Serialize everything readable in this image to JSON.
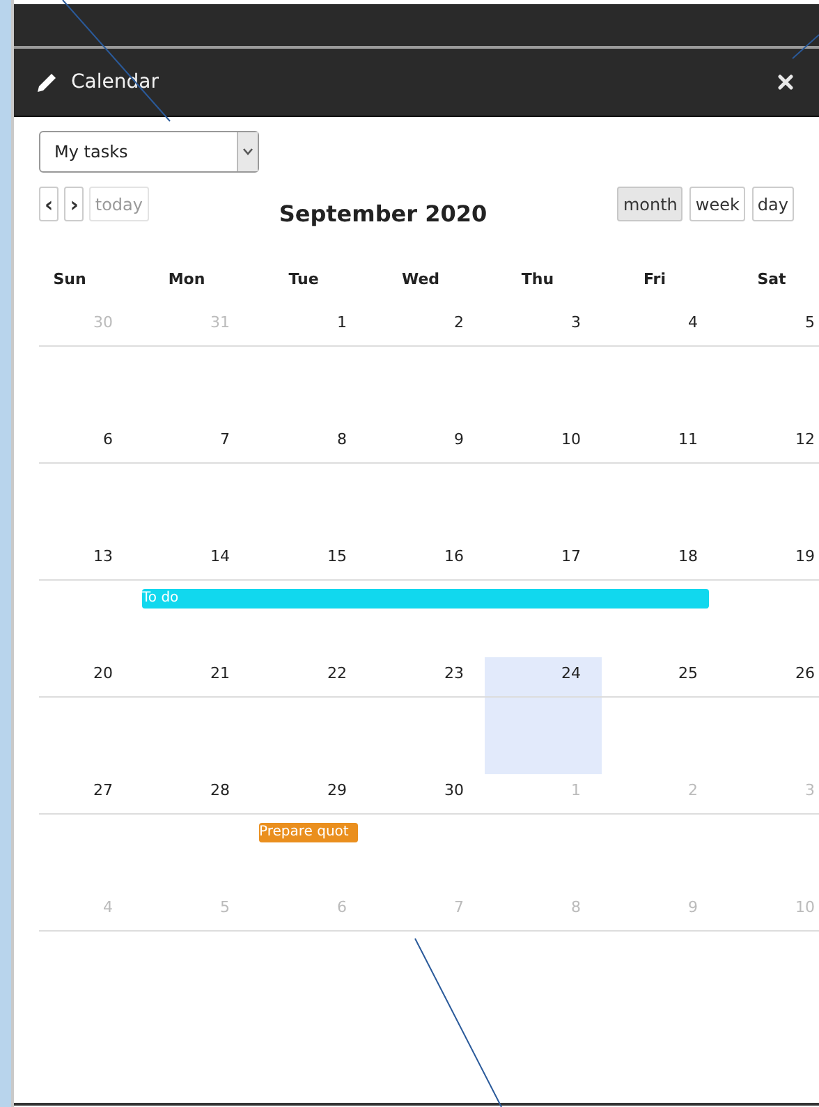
{
  "dialog": {
    "title": "Calendar"
  },
  "calendar_select": {
    "value": "My tasks"
  },
  "nav_buttons": [
    {
      "kind": "prev",
      "label": "‹"
    },
    {
      "kind": "next",
      "label": "›"
    },
    {
      "kind": "today",
      "label": "today",
      "disabled": true
    }
  ],
  "month_title": "September 2020",
  "views": [
    {
      "label": "month",
      "selected": true
    },
    {
      "label": "week",
      "selected": false
    },
    {
      "label": "day",
      "selected": false
    }
  ],
  "weekdays": [
    "Sun",
    "Mon",
    "Tue",
    "Wed",
    "Thu",
    "Fri",
    "Sat"
  ],
  "weeks": [
    {
      "days": [
        {
          "day": "30",
          "other_month": true,
          "today": false
        },
        {
          "day": "31",
          "other_month": true,
          "today": false
        },
        {
          "day": "1",
          "other_month": false,
          "today": false
        },
        {
          "day": "2",
          "other_month": false,
          "today": false
        },
        {
          "day": "3",
          "other_month": false,
          "today": false
        },
        {
          "day": "4",
          "other_month": false,
          "today": false
        },
        {
          "day": "5",
          "other_month": false,
          "today": false
        }
      ]
    },
    {
      "days": [
        {
          "day": "6",
          "other_month": false,
          "today": false
        },
        {
          "day": "7",
          "other_month": false,
          "today": false
        },
        {
          "day": "8",
          "other_month": false,
          "today": false
        },
        {
          "day": "9",
          "other_month": false,
          "today": false
        },
        {
          "day": "10",
          "other_month": false,
          "today": false
        },
        {
          "day": "11",
          "other_month": false,
          "today": false
        },
        {
          "day": "12",
          "other_month": false,
          "today": false
        }
      ]
    },
    {
      "days": [
        {
          "day": "13",
          "other_month": false,
          "today": false
        },
        {
          "day": "14",
          "other_month": false,
          "today": false,
          "event": {
            "title": "To do",
            "color": "#11d8ee"
          }
        },
        {
          "day": "15",
          "other_month": false,
          "today": false,
          "event_continues": true
        },
        {
          "day": "16",
          "other_month": false,
          "today": false,
          "event_continues": true
        },
        {
          "day": "17",
          "other_month": false,
          "today": false,
          "event_continues": true
        },
        {
          "day": "18",
          "other_month": false,
          "today": false,
          "event_continues": true
        },
        {
          "day": "19",
          "other_month": false,
          "today": false,
          "event_continues": false
        }
      ]
    },
    {
      "days": [
        {
          "day": "20",
          "other_month": false,
          "today": false
        },
        {
          "day": "21",
          "other_month": false,
          "today": false
        },
        {
          "day": "22",
          "other_month": false,
          "today": false
        },
        {
          "day": "23",
          "other_month": false,
          "today": false
        },
        {
          "day": "24",
          "other_month": false,
          "today": true
        },
        {
          "day": "25",
          "other_month": false,
          "today": false
        },
        {
          "day": "26",
          "other_month": false,
          "today": false
        }
      ]
    },
    {
      "days": [
        {
          "day": "27",
          "other_month": false,
          "today": false
        },
        {
          "day": "28",
          "other_month": false,
          "today": false
        },
        {
          "day": "29",
          "other_month": false,
          "today": false,
          "event": {
            "title": "Prepare quot",
            "color": "#ea8f1e"
          }
        },
        {
          "day": "30",
          "other_month": false,
          "today": false,
          "event_continues": false
        },
        {
          "day": "1",
          "other_month": true,
          "today": false
        },
        {
          "day": "2",
          "other_month": true,
          "today": false
        },
        {
          "day": "3",
          "other_month": true,
          "today": false
        }
      ]
    },
    {
      "days": [
        {
          "day": "4",
          "other_month": true,
          "today": false
        },
        {
          "day": "5",
          "other_month": true,
          "today": false
        },
        {
          "day": "6",
          "other_month": true,
          "today": false
        },
        {
          "day": "7",
          "other_month": true,
          "today": false
        },
        {
          "day": "8",
          "other_month": true,
          "today": false
        },
        {
          "day": "9",
          "other_month": true,
          "today": false
        },
        {
          "day": "10",
          "other_month": true,
          "today": false
        }
      ]
    }
  ]
}
